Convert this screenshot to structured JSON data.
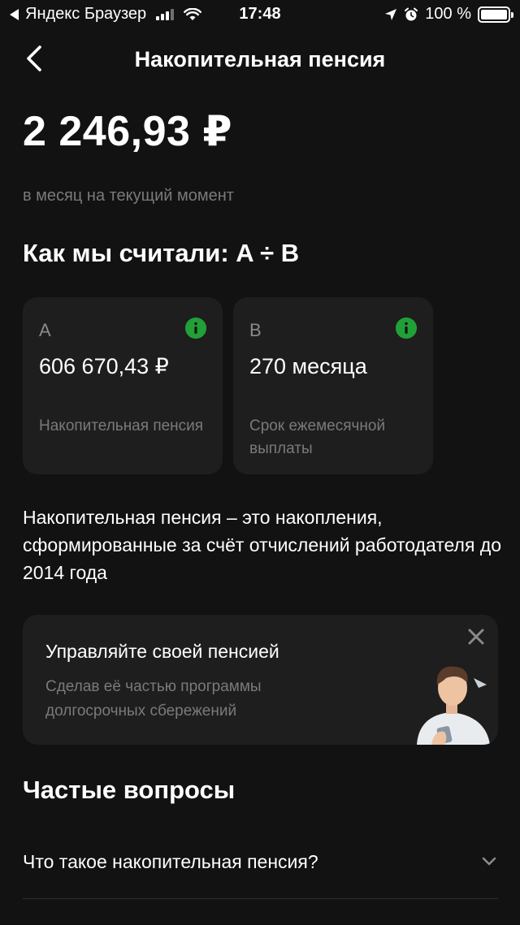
{
  "status_bar": {
    "carrier": "Яндекс Браузер",
    "time": "17:48",
    "battery_text": "100 %",
    "battery_level": 1.0
  },
  "header": {
    "title": "Накопительная пенсия"
  },
  "summary": {
    "amount": "2 246,93 ₽",
    "subtitle": "в месяц на текущий момент"
  },
  "calc": {
    "title": "Как мы считали: A ÷ B",
    "cards": [
      {
        "letter": "A",
        "value": "606 670,43 ₽",
        "label": "Накопительная пенсия",
        "icon": "info-icon"
      },
      {
        "letter": "B",
        "value": "270 месяца",
        "label": "Срок ежемесячной выплаты",
        "icon": "info-icon"
      }
    ]
  },
  "description": "Накопительная пенсия – это накопления, сформированные за счёт отчислений работодателя до 2014 года",
  "promo": {
    "title": "Управляйте своей пенсией",
    "text": "Сделав её частью программы долгосрочных сбережений"
  },
  "faq": {
    "title": "Частые вопросы",
    "items": [
      {
        "question": "Что такое накопительная пенсия?"
      }
    ]
  },
  "colors": {
    "background": "#121212",
    "card": "#1e1e1e",
    "accent_green": "#21a038",
    "muted_text": "#7a7a7a"
  }
}
